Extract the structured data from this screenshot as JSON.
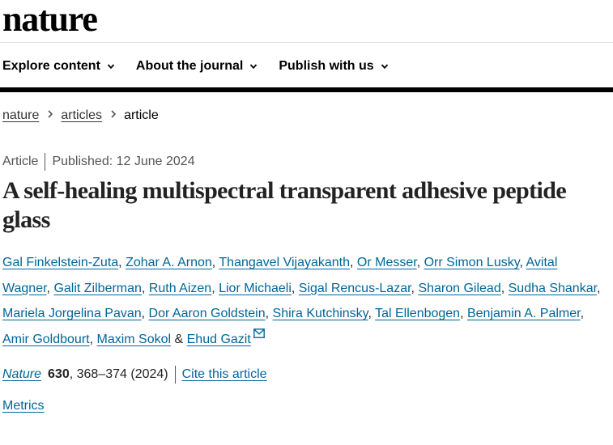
{
  "header": {
    "logo": "nature"
  },
  "nav": {
    "items": [
      {
        "label": "Explore content"
      },
      {
        "label": "About the journal"
      },
      {
        "label": "Publish with us"
      }
    ]
  },
  "breadcrumb": {
    "items": [
      "nature",
      "articles"
    ],
    "current": "article"
  },
  "article": {
    "type": "Article",
    "published": "Published: 12 June 2024",
    "title": "A self-healing multispectral transparent adhesive peptide glass",
    "authors": [
      "Gal Finkelstein-Zuta",
      "Zohar A. Arnon",
      "Thangavel Vijayakanth",
      "Or Messer",
      "Orr Simon Lusky",
      "Avital Wagner",
      "Galit Zilberman",
      "Ruth Aizen",
      "Lior Michaeli",
      "Sigal Rencus-Lazar",
      "Sharon Gilead",
      "Sudha Shankar",
      "Mariela Jorgelina Pavan",
      "Dor Aaron Goldstein",
      "Shira Kutchinsky",
      "Tal Ellenbogen",
      "Benjamin A. Palmer",
      "Amir Goldbourt",
      "Maxim Sokol",
      "Ehud Gazit"
    ],
    "journal": "Nature",
    "volume": "630",
    "pages_year": ", 368–374 (2024)",
    "cite_label": "Cite this article",
    "metrics_label": "Metrics"
  },
  "colors": {
    "link": "#006699",
    "text": "#222222",
    "bar": "#000000"
  },
  "icons": [
    "chevron-down-icon",
    "chevron-right-icon",
    "mail-icon"
  ]
}
